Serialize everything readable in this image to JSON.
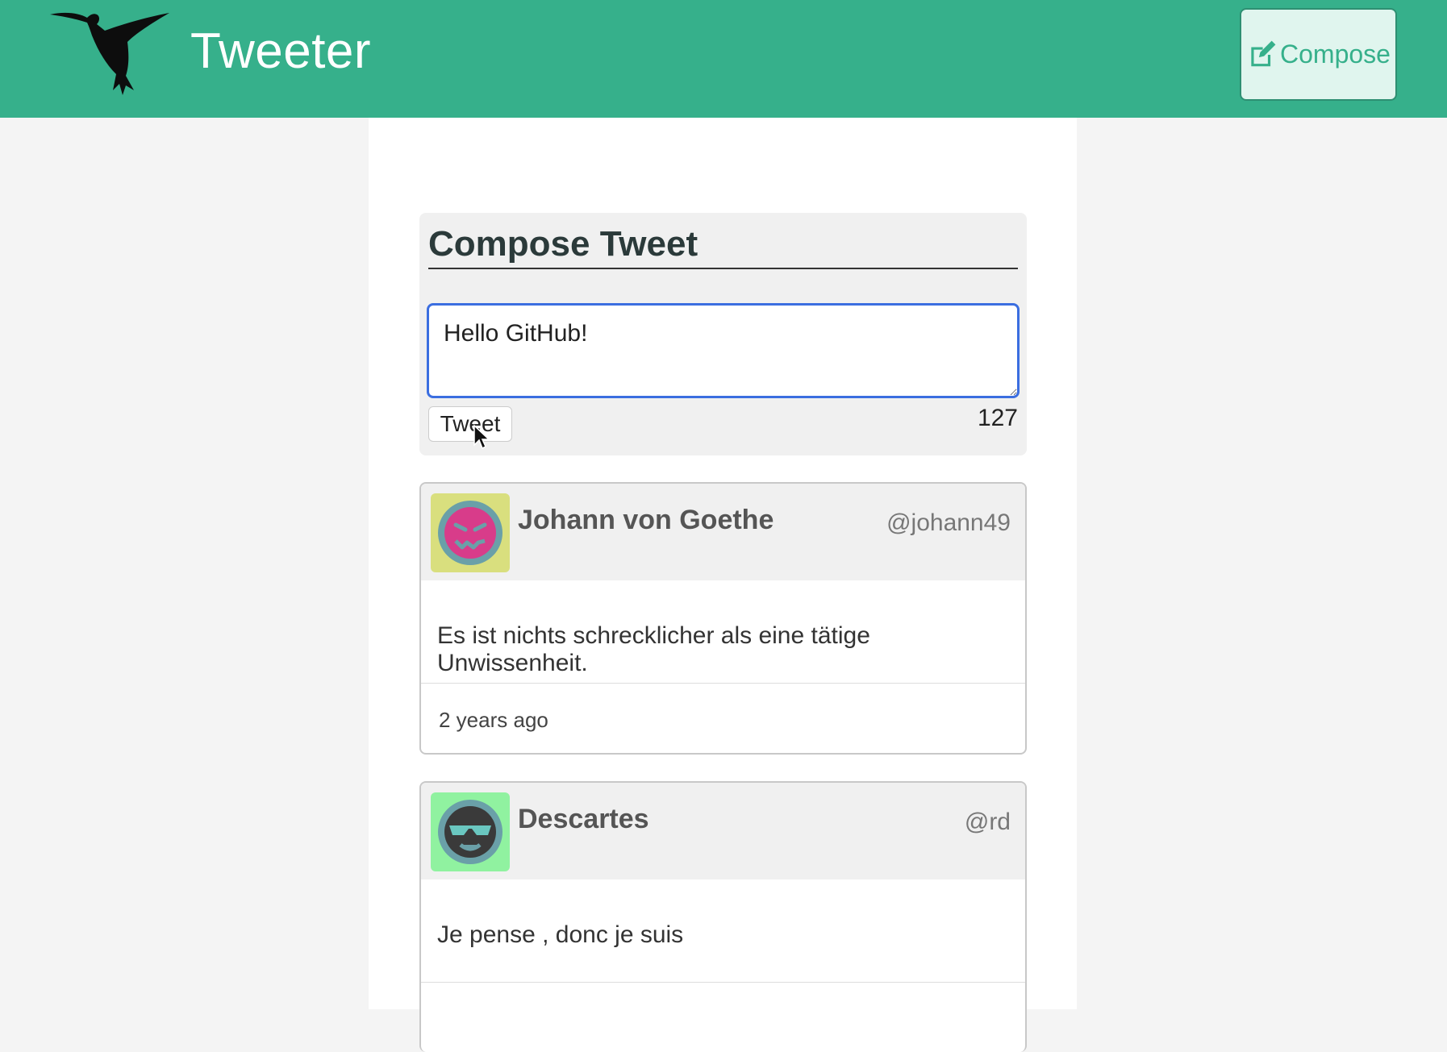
{
  "header": {
    "app_title": "Tweeter",
    "compose_label": "Compose",
    "logo_icon": "hummingbird-icon",
    "compose_icon": "edit-icon"
  },
  "compose": {
    "heading": "Compose Tweet",
    "input_value": "Hello GitHub!",
    "tweet_button": "Tweet",
    "char_count": "127"
  },
  "tweets": [
    {
      "author": "Johann von Goethe",
      "handle": "@johann49",
      "content": "Es ist nichts schrecklicher als eine tätige Unwissenheit.",
      "time": "2 years ago",
      "avatar_bg": "#d9df7e"
    },
    {
      "author": "Descartes",
      "handle": "@rd",
      "content": "Je pense , donc je suis",
      "time": "",
      "avatar_bg": "#90f2a0"
    }
  ],
  "colors": {
    "navbar": "#36b08b",
    "accent": "#3b6ee0"
  }
}
